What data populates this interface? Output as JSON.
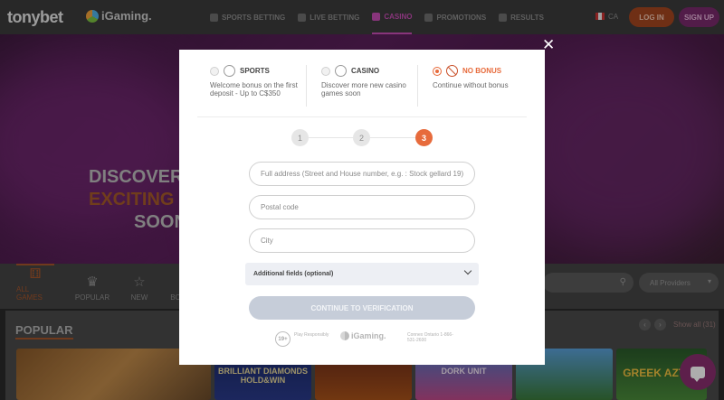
{
  "topnav": {
    "logo": "tonybet",
    "igaming": "iGaming.",
    "links": [
      {
        "label": "SPORTS BETTING",
        "active": false
      },
      {
        "label": "LIVE BETTING",
        "active": false
      },
      {
        "label": "CASINO",
        "active": true
      },
      {
        "label": "PROMOTIONS",
        "active": false
      },
      {
        "label": "RESULTS",
        "active": false
      }
    ],
    "lang": "CA",
    "login_label": "LOG IN",
    "signup_label": "SIGN UP"
  },
  "hero": {
    "line1": "DISCOVER",
    "line2": "EXCITING G",
    "line3": "SOON"
  },
  "categories": [
    {
      "label": "ALL GAMES",
      "icon": "dice-icon",
      "glyph": "⚅",
      "active": true
    },
    {
      "label": "POPULAR",
      "icon": "crown-icon",
      "glyph": "♛",
      "active": false
    },
    {
      "label": "NEW",
      "icon": "star-icon",
      "glyph": "☆",
      "active": false
    },
    {
      "label": "BO",
      "icon": "bonus-icon",
      "glyph": "",
      "active": false
    }
  ],
  "providers_label": "All Providers",
  "popular": {
    "title": "POPULAR",
    "show_all": "Show all (31)",
    "games": [
      "",
      "BRILLIANT DIAMONDS HOLD&WIN",
      "",
      "DORK UNIT",
      "",
      "GREEK AZTEC"
    ]
  },
  "modal": {
    "bonus_options": [
      {
        "name": "SPORTS",
        "icon": "soccer-ball-icon",
        "desc": "Welcome bonus on the first deposit - Up to C$350",
        "selected": false
      },
      {
        "name": "CASINO",
        "icon": "casino-chip-icon",
        "desc": "Discover more new casino games soon",
        "selected": false
      },
      {
        "name": "NO BONUS",
        "icon": "no-bonus-icon",
        "desc": "Continue without bonus",
        "selected": true
      }
    ],
    "steps": [
      "1",
      "2",
      "3"
    ],
    "active_step": 3,
    "fields": {
      "address_placeholder": "Full address (Street and House number, e.g. : Stock gellard 19)",
      "postal_placeholder": "Postal code",
      "city_placeholder": "City"
    },
    "additional_label": "Additional fields (optional)",
    "verify_label": "CONTINUE TO VERIFICATION",
    "footer": {
      "age": "19+",
      "play_resp": "Play Responsibly",
      "igaming": "iGaming.",
      "connex": "Connex Ontario 1-866-531-2600"
    }
  },
  "colors": {
    "accent": "#e76b3c",
    "brand_purple": "#c94fb5",
    "verify_disabled": "#c6cdd9"
  }
}
